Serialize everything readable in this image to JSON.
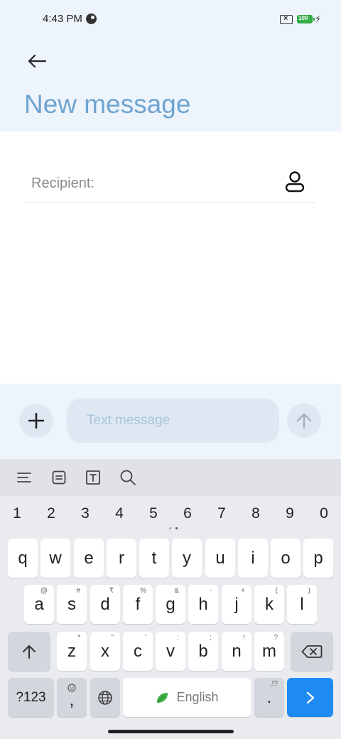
{
  "status_bar": {
    "time": "4:43 PM",
    "battery_level": "100",
    "icons": [
      "data-saver-icon",
      "sim-error-icon",
      "battery-icon",
      "charging-icon"
    ]
  },
  "header": {
    "back_icon": "arrow-left-icon",
    "title": "New message"
  },
  "recipient": {
    "label": "Recipient:",
    "contact_icon": "person-icon"
  },
  "compose": {
    "attach_icon": "plus-icon",
    "placeholder": "Text message",
    "value": "",
    "send_icon": "arrow-up-icon"
  },
  "keyboard": {
    "toolbar_icons": [
      "menu-icon",
      "clipboard-icon",
      "text-format-icon",
      "search-icon"
    ],
    "number_row": [
      "1",
      "2",
      "3",
      "4",
      "5",
      "6",
      "7",
      "8",
      "9",
      "0"
    ],
    "row1": [
      {
        "key": "q",
        "hint": ""
      },
      {
        "key": "w",
        "hint": ""
      },
      {
        "key": "e",
        "hint": ""
      },
      {
        "key": "r",
        "hint": ""
      },
      {
        "key": "t",
        "hint": ""
      },
      {
        "key": "y",
        "hint": ""
      },
      {
        "key": "u",
        "hint": ""
      },
      {
        "key": "i",
        "hint": ""
      },
      {
        "key": "o",
        "hint": ""
      },
      {
        "key": "p",
        "hint": ""
      }
    ],
    "row2": [
      {
        "key": "a",
        "hint": "@"
      },
      {
        "key": "s",
        "hint": "#"
      },
      {
        "key": "d",
        "hint": "₹"
      },
      {
        "key": "f",
        "hint": "%"
      },
      {
        "key": "g",
        "hint": "&"
      },
      {
        "key": "h",
        "hint": "-"
      },
      {
        "key": "j",
        "hint": "+"
      },
      {
        "key": "k",
        "hint": "("
      },
      {
        "key": "l",
        "hint": ")"
      }
    ],
    "row3": [
      {
        "key": "z",
        "hint": "*"
      },
      {
        "key": "x",
        "hint": "\""
      },
      {
        "key": "c",
        "hint": "'"
      },
      {
        "key": "v",
        "hint": ":"
      },
      {
        "key": "b",
        "hint": ";"
      },
      {
        "key": "n",
        "hint": "!"
      },
      {
        "key": "m",
        "hint": "?"
      }
    ],
    "symbols_label": "?123",
    "comma_label": ",",
    "space_label": "English",
    "period_label": ".",
    "period_hint": ",!?",
    "shift_icon": "shift-arrow-icon",
    "backspace_icon": "backspace-icon",
    "globe_icon": "globe-icon",
    "emoji_icon": "emoji-icon",
    "enter_icon": "chevron-right-icon",
    "accent_color": "#1e8bf3"
  }
}
